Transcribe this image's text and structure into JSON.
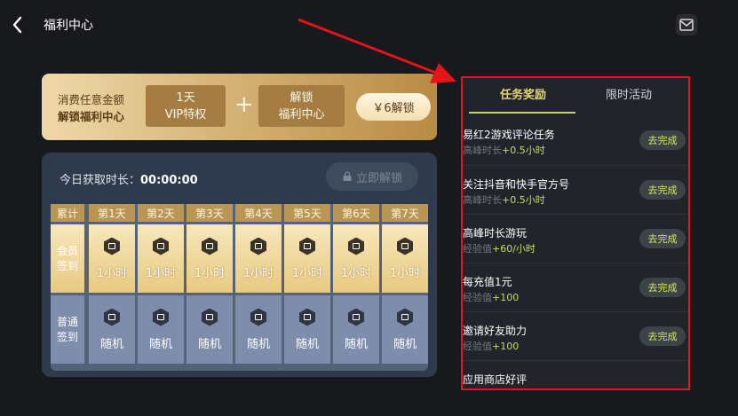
{
  "header": {
    "title": "福利中心",
    "back_icon": "back-arrow-icon",
    "mail_icon": "mail-icon"
  },
  "banner": {
    "line1": "消费任意金额",
    "line2": "解锁福利中心",
    "box1_line1": "1天",
    "box1_line2": "VIP特权",
    "plus": "+",
    "box2_line1": "解锁",
    "box2_line2": "福利中心",
    "button": "￥6解锁"
  },
  "card": {
    "today_label": "今日获取时长：",
    "today_value": "00:00:00",
    "unlock_button": "立即解锁",
    "grid": {
      "corner": "累计",
      "days": [
        "第1天",
        "第2天",
        "第3天",
        "第4天",
        "第5天",
        "第6天",
        "第7天"
      ],
      "member_row": {
        "label1": "会员",
        "label2": "签到",
        "value": "1小时"
      },
      "normal_row": {
        "label1": "普通",
        "label2": "签到",
        "value": "随机"
      }
    }
  },
  "panel": {
    "tabs": [
      {
        "label": "任务奖励",
        "active": true
      },
      {
        "label": "限时活动",
        "active": false
      }
    ],
    "tasks": [
      {
        "name": "易红2游戏评论任务",
        "sub_label": "高峰时长",
        "sub_value": "+0.5小时",
        "button": "去完成"
      },
      {
        "name": "关注抖音和快手官方号",
        "sub_label": "高峰时长",
        "sub_value": "+0.5小时",
        "button": "去完成"
      },
      {
        "name": "高峰时长游玩",
        "sub_label": "经验值",
        "sub_value": "+60/小时",
        "button": "去完成"
      },
      {
        "name": "每充值1元",
        "sub_label": "经验值",
        "sub_value": "+100",
        "button": "去完成"
      },
      {
        "name": "邀请好友助力",
        "sub_label": "经验值",
        "sub_value": "+100",
        "button": "去完成"
      },
      {
        "name": "应用商店好评",
        "sub_label": "",
        "sub_value": "",
        "button": ""
      }
    ]
  },
  "colors": {
    "accent_gold": "#e5d56b",
    "highlight_red": "#e3141a",
    "bg": "#18191c"
  }
}
